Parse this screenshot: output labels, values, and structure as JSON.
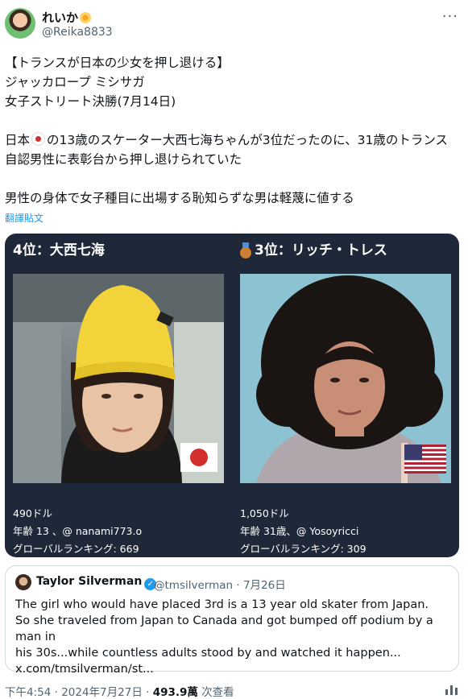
{
  "author": {
    "display_name": "れいか",
    "handle": "@Reika8833"
  },
  "header": {
    "more_label": "···"
  },
  "tweet": {
    "lines": [
      "【トランスが日本の少女を押し退ける】",
      "ジャッカロープ ミシサガ",
      "女子ストリート決勝(7月14日)"
    ],
    "para2_before": "日本",
    "para2_after": "の13歳のスケーター大西七海ちゃんが3位だったのに、31歳のトランス自認男性に表彰台から押し退けられていた",
    "para3": "男性の身体で女子種目に出場する恥知らずな男は軽蔑に値する"
  },
  "translate_label": "翻譯貼文",
  "card": {
    "left": {
      "title": "4位：大西七海",
      "prize": "490ドル",
      "age": "年齢 13 、@ nanami773.o",
      "ranking": "グローバルランキング: 669"
    },
    "right": {
      "title": "3位：リッチ・トレス",
      "prize": "1,050ドル",
      "age": "年齢 31歳、@ Yosoyricci",
      "ranking": "グローバルランキング: 309"
    }
  },
  "quote": {
    "name": "Taylor Silverman",
    "handle_date": "@tmsilverman · 7月26日",
    "lines": [
      "The girl who would have placed 3rd is a 13 year old skater from Japan.",
      "So she traveled from Japan to Canada and got bumped off podium by a man in",
      "his 30s...while countless adults stood by and watched it happen...",
      "x.com/tmsilverman/st..."
    ]
  },
  "meta": {
    "time_date": "下午4:54 · 2024年7月27日 · ",
    "views": "493.9萬",
    "views_label": " 次查看"
  }
}
